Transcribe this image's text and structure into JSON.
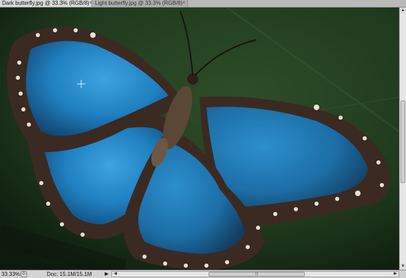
{
  "tabs": [
    {
      "label": "Dark butterfly.jpg @ 33.3% (RGB/8)",
      "close_icon": "x-icon",
      "active": true
    },
    {
      "label": "Light butterfly.jpg @ 33.3% (RGB/8)",
      "close_icon": "x-icon",
      "active": false
    }
  ],
  "canvas": {
    "image_subject": "blue morpho butterfly on dark green leaf",
    "colors": {
      "wing_blue": "#1f7fc0",
      "wing_dark": "#3a2a22",
      "leaf": "#1f3a1d",
      "spots": "#e8e2d4"
    }
  },
  "status": {
    "zoom": "33.33%",
    "doc_info": "Doc: 15.1M/15.1M",
    "menu_icon": "triangle-right-icon"
  },
  "scrollbars": {
    "vertical_arrows": [
      "arrow-up-icon",
      "arrow-down-icon"
    ],
    "horizontal_arrows": [
      "arrow-left-icon",
      "arrow-right-icon"
    ]
  }
}
